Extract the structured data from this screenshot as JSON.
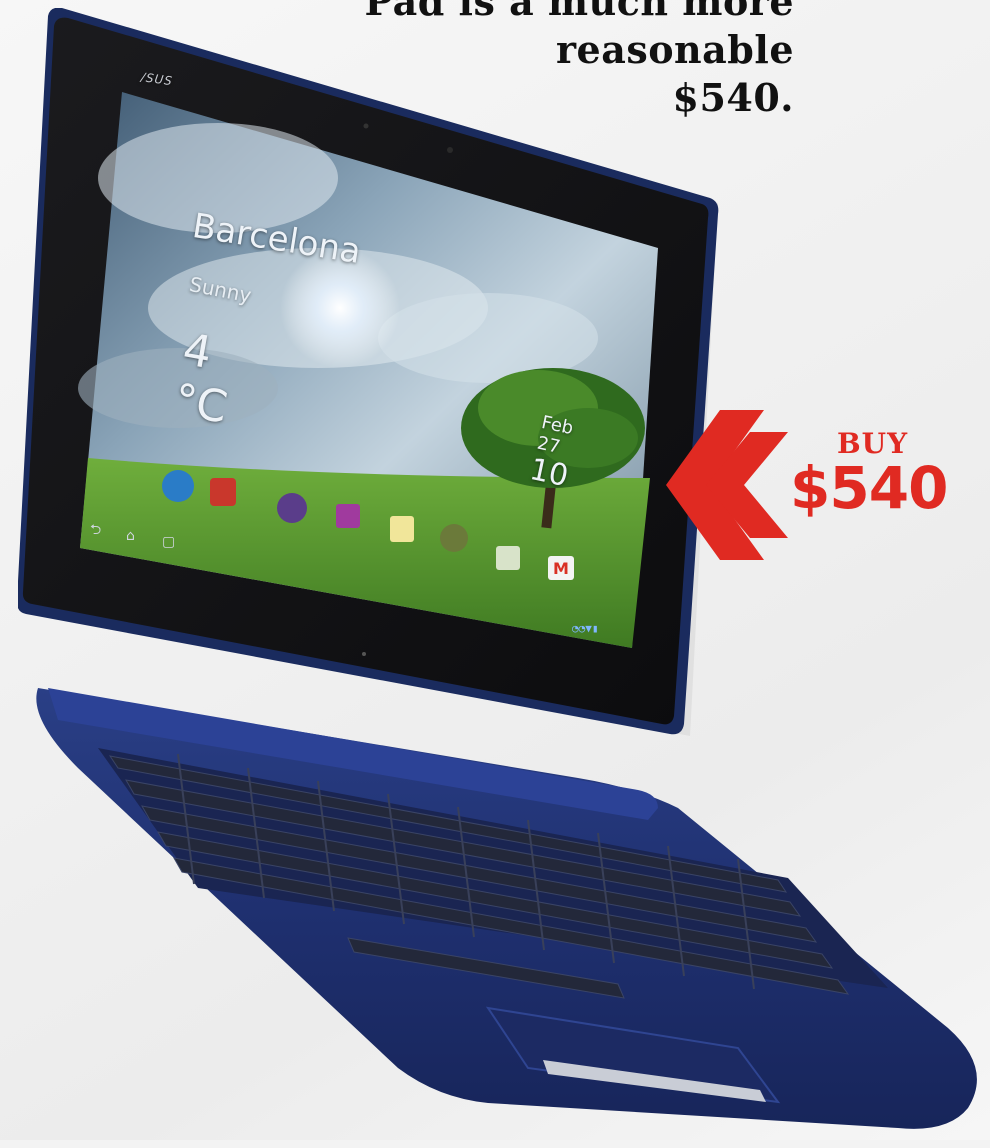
{
  "caption": {
    "line1": "Pad is a much more",
    "line2": "reasonable",
    "line3": "$540."
  },
  "buy_callout": {
    "label": "BUY",
    "price": "$540",
    "color": "#e02a22"
  },
  "tablet": {
    "brand": "/SUS",
    "city": "Barcelona",
    "weather": "Sunny",
    "temperature": "4 °C",
    "date": "Feb 27",
    "time": "10",
    "body_color": "#1d2f66",
    "screen_sky": "#6f8da8",
    "grass": "#5d9b35",
    "app_icons": [
      "browser-icon",
      "youtube-icon",
      "camera-icon",
      "gallery-icon",
      "notes-icon",
      "settings-icon",
      "maps-icon",
      "gmail-icon"
    ]
  }
}
